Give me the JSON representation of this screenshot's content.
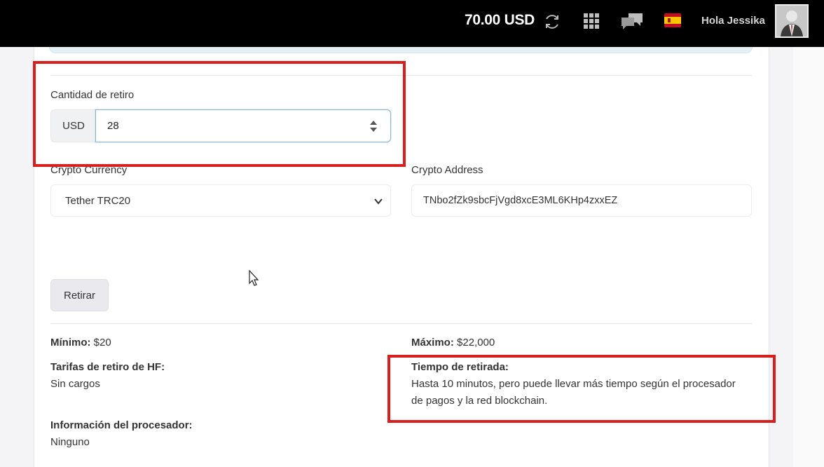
{
  "header": {
    "balance": "70.00 USD",
    "greeting": "Hola Jessika"
  },
  "icons": {
    "refresh": "refresh-icon",
    "apps": "grid-icon",
    "chat": "chat-icon",
    "language": "spain-flag-icon",
    "user": "avatar"
  },
  "form": {
    "amount_label": "Cantidad de retiro",
    "currency_addon": "USD",
    "amount_value": "28",
    "crypto_currency_label": "Crypto Currency",
    "crypto_currency_value": "Tether TRC20",
    "crypto_address_label": "Crypto Address",
    "crypto_address_value": "TNbo2fZk9sbcFjVgd8xcE3ML6KHp4zxxEZ",
    "submit_label": "Retirar"
  },
  "info": {
    "min_label": "Mínimo:",
    "min_value": "$20",
    "max_label": "Máximo:",
    "max_value": "$22,000",
    "fees_title": "Tarifas de retiro de HF:",
    "fees_value": "Sin cargos",
    "time_title": "Tiempo de retirada:",
    "time_line1": "Hasta 10 minutos, pero puede llevar más tiempo según el procesador",
    "time_line2": "de pagos y la red blockchain.",
    "processor_title": "Información del procesador:",
    "processor_value": "Ninguno"
  },
  "colors": {
    "highlight_box": "#d91e1e",
    "topbar": "#000000",
    "input_focus_border": "#86b7d8"
  }
}
